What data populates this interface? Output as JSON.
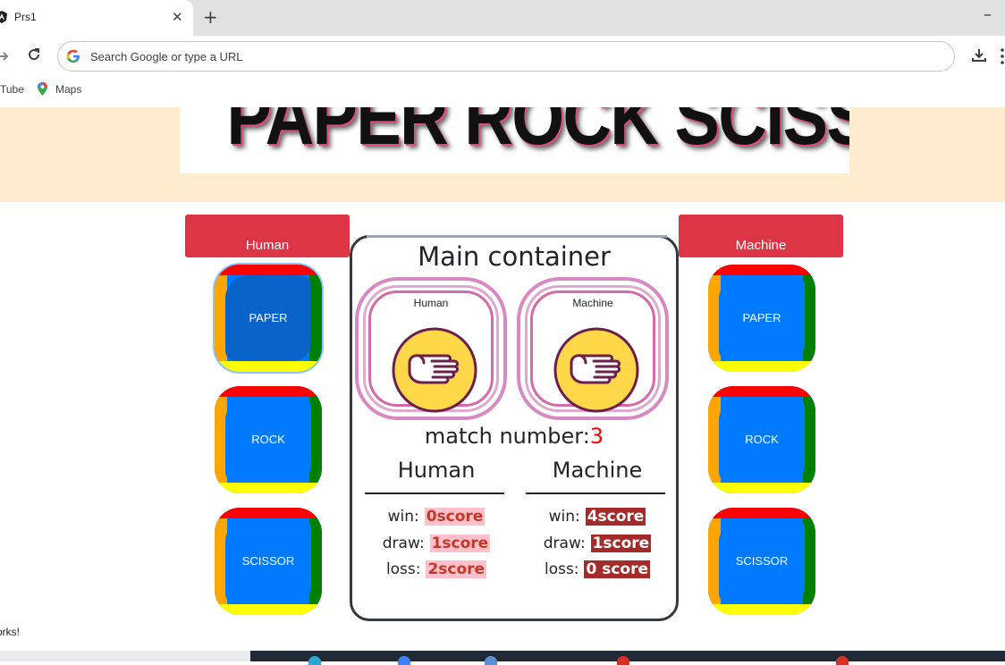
{
  "browser": {
    "tab_title": "Prs1",
    "tab_close": "✕",
    "new_tab": "+",
    "minimize": "–",
    "omnibox_placeholder": "Search Google or type a URL",
    "bookmarks": [
      {
        "label": "Tube"
      },
      {
        "label": "Maps"
      }
    ]
  },
  "page": {
    "banner_title": "PAPER ROCK SCISSOR",
    "human_label": "Human",
    "machine_label": "Machine",
    "human_choices": [
      "PAPER",
      "ROCK",
      "SCISSOR"
    ],
    "machine_choices": [
      "PAPER",
      "ROCK",
      "SCISSOR"
    ],
    "main": {
      "title": "Main container",
      "human_card_caption": "Human",
      "machine_card_caption": "Machine",
      "match_label": "match number:",
      "match_number": "3",
      "human_col_title": "Human",
      "machine_col_title": "Machine",
      "human_scores": [
        {
          "label": "win:",
          "value": "0score"
        },
        {
          "label": "draw:",
          "value": "1score"
        },
        {
          "label": "loss:",
          "value": "2score"
        }
      ],
      "machine_scores": [
        {
          "label": "win:",
          "value": "4score"
        },
        {
          "label": "draw:",
          "value": "1score"
        },
        {
          "label": "loss:",
          "value": "0 score"
        }
      ]
    },
    "footer_text": "orks!"
  },
  "colors": {
    "header_band": "#ffebcd",
    "side_label_bg": "#dc3545",
    "choice_fill": "#007bff",
    "match_number": "#ff0000",
    "human_pill": "#ffc0cb",
    "machine_pill": "#a52a2a"
  }
}
